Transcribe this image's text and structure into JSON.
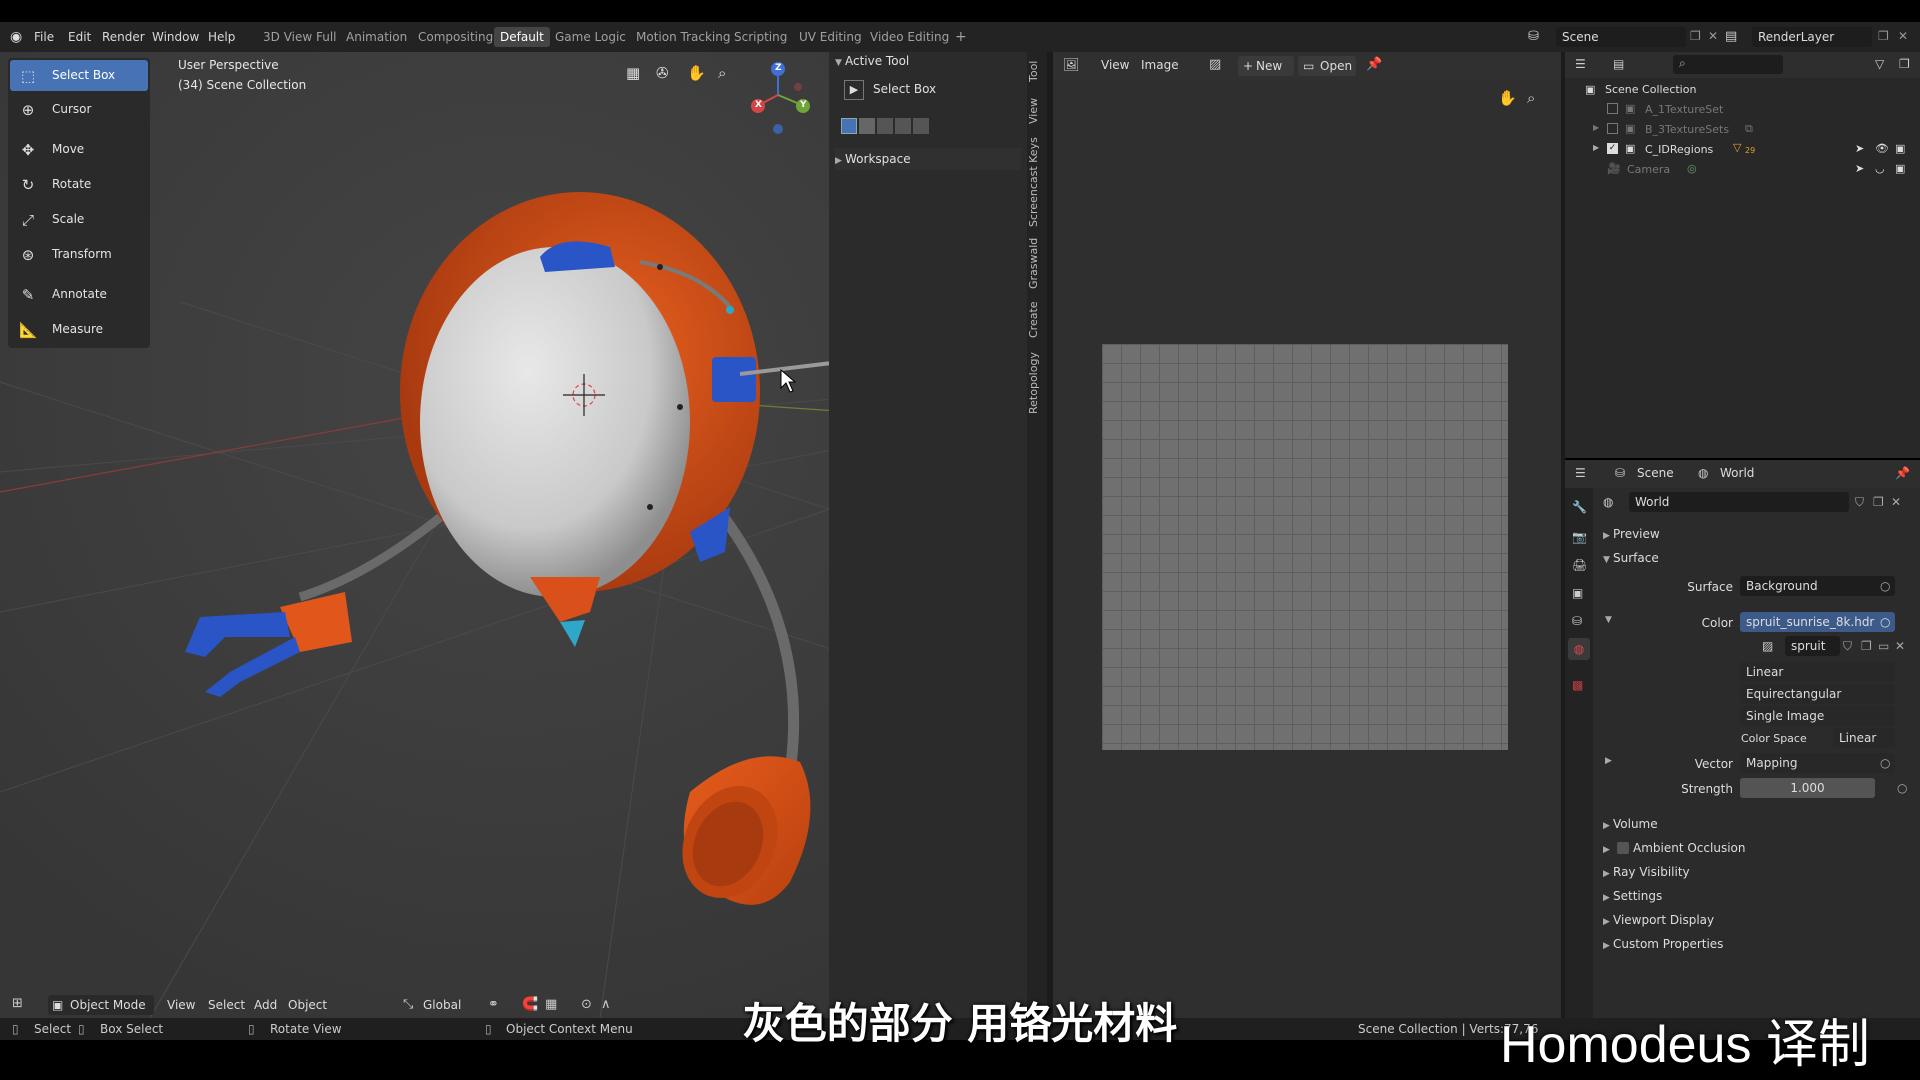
{
  "topbar": {
    "menus": [
      "File",
      "Edit",
      "Render",
      "Window",
      "Help"
    ],
    "workspaces": [
      "3D View Full",
      "Animation",
      "Compositing",
      "Default",
      "Game Logic",
      "Motion Tracking",
      "Scripting",
      "UV Editing",
      "Video Editing"
    ],
    "active_workspace": "Default",
    "add_tab": "+",
    "scene_label": "Scene",
    "render_layer_label": "RenderLayer"
  },
  "viewport": {
    "perspective": "User Perspective",
    "collection": "(34) Scene Collection",
    "axes": {
      "x": "X",
      "y": "Y",
      "z": "Z"
    },
    "tools": [
      "Select Box",
      "Cursor",
      "Move",
      "Rotate",
      "Scale",
      "Transform",
      "Annotate",
      "Measure"
    ],
    "active_tool": "Select Box",
    "header": {
      "mode": "Object Mode",
      "view": "View",
      "select": "Select",
      "add": "Add",
      "object": "Object",
      "orientation": "Global"
    }
  },
  "npanel": {
    "active_tool_title": "Active Tool",
    "select_box": "Select Box",
    "workspace_title": "Workspace",
    "tabs": [
      "Tool",
      "View",
      "Screencast Keys",
      "Graswald",
      "Create",
      "Retopology"
    ]
  },
  "image_editor": {
    "view": "View",
    "image": "Image",
    "new": "New",
    "open": "Open"
  },
  "outliner": {
    "root": "Scene Collection",
    "items": [
      {
        "label": "A_1TextureSet",
        "checked": false,
        "dim": true
      },
      {
        "label": "B_3TextureSets",
        "checked": false,
        "dim": true
      },
      {
        "label": "C_IDRegions",
        "checked": true,
        "dim": false,
        "badge": "29"
      },
      {
        "label": "Camera",
        "checked": null,
        "dim": true
      }
    ]
  },
  "properties": {
    "tab_scene": "Scene",
    "tab_world": "World",
    "world_name": "World",
    "preview": "Preview",
    "surface_section": "Surface",
    "surface_label": "Surface",
    "surface_value": "Background",
    "color_label": "Color",
    "color_value": "spruit_sunrise_8k.hdr",
    "image_short": "spruit",
    "interpolation": "Linear",
    "projection": "Equirectangular",
    "source": "Single Image",
    "color_space_label": "Color Space",
    "color_space_value": "Linear",
    "vector_label": "Vector",
    "vector_value": "Mapping",
    "strength_label": "Strength",
    "strength_value": "1.000",
    "sections": [
      "Volume",
      "Ambient Occlusion",
      "Ray Visibility",
      "Settings",
      "Viewport Display",
      "Custom Properties"
    ]
  },
  "statusbar": {
    "select": "Select",
    "box_select": "Box Select",
    "rotate_view": "Rotate View",
    "context_menu": "Object Context Menu",
    "stats": "Scene Collection | Verts:77,76"
  },
  "overlay": {
    "subtitle": "灰色的部分 用铬光材料",
    "watermark": "Homodeus 译制"
  },
  "colors": {
    "accent": "#4772b3",
    "robot_orange": "#d9501a",
    "robot_blue": "#2a55c7"
  }
}
